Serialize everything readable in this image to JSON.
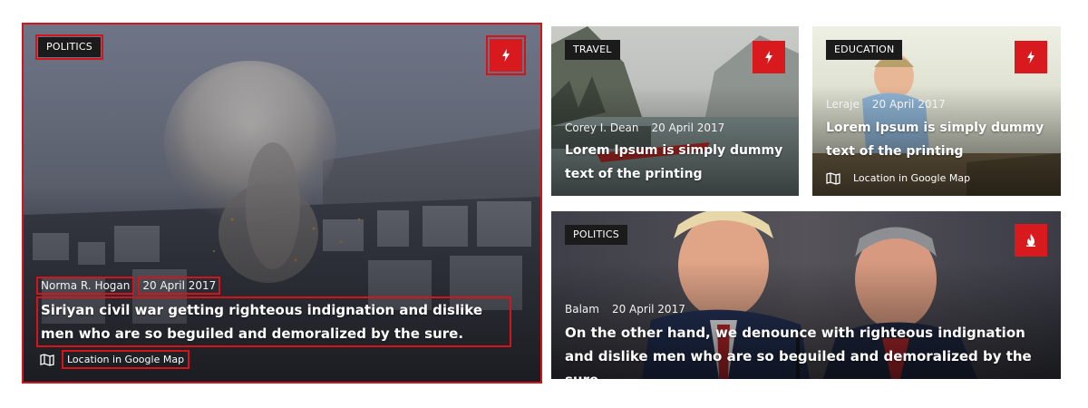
{
  "cards": [
    {
      "category": "POLITICS",
      "action_icon": "lightning-icon",
      "author": "Norma R. Hogan",
      "date": "20 April 2017",
      "title": "Siriyan civil war getting righteous indignation and dislike men who are so beguiled and demoralized by the sure.",
      "location_label": "Location in Google Map",
      "location_icon": "map-icon"
    },
    {
      "category": "TRAVEL",
      "action_icon": "lightning-icon",
      "author": "Corey I. Dean",
      "date": "20 April 2017",
      "title": "Lorem Ipsum is simply dummy text of the printing"
    },
    {
      "category": "EDUCATION",
      "action_icon": "lightning-icon",
      "author": "Leraje",
      "date": "20 April 2017",
      "title": "Lorem Ipsum is simply dummy text of the printing",
      "location_label": "Location in Google Map",
      "location_icon": "map-icon"
    },
    {
      "category": "POLITICS",
      "action_icon": "fire-icon",
      "author": "Balam",
      "date": "20 April 2017",
      "title": "On the other hand, we denounce with righteous indignation and dislike men who are so beguiled and demoralized by the sure."
    }
  ],
  "colors": {
    "accent": "#d81a1f",
    "badge_bg": "#1b1b1b",
    "highlight": "#d4141a"
  }
}
